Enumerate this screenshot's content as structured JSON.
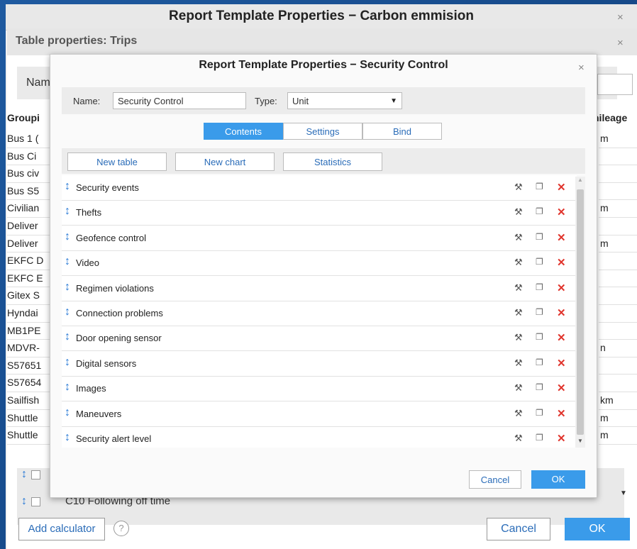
{
  "outer_dialog": {
    "title": "Report Template Properties − Carbon emmision",
    "close": "×"
  },
  "middle_dialog": {
    "title": "Table properties: Trips",
    "close": "×",
    "name_label": "Nam",
    "grouping_header": "Groupi",
    "mileage_header": "nileage",
    "left_rows": [
      "Bus 1 (",
      "Bus Ci",
      "Bus civ",
      "Bus S5",
      "Civilian",
      "Deliver",
      "Deliver",
      "EKFC D",
      "EKFC E",
      "Gitex S",
      "Hyndai",
      "MB1PE",
      "MDVR-",
      "S57651",
      "S57654",
      "Sailfish",
      "Shuttle",
      "Shuttle"
    ],
    "right_rows": [
      "m",
      "",
      "",
      "",
      "m",
      "",
      "m",
      "",
      "",
      "",
      "",
      "",
      "n",
      "",
      "",
      "km",
      "m",
      "m"
    ],
    "lower_text": "C10 Following off time",
    "add_calculator": "Add calculator",
    "help": "?",
    "cancel": "Cancel",
    "ok": "OK"
  },
  "inner_dialog": {
    "title": "Report Template Properties − Security Control",
    "close": "×",
    "name_label": "Name:",
    "name_value": "Security Control",
    "type_label": "Type:",
    "type_value": "Unit",
    "tabs": [
      "Contents",
      "Settings",
      "Bind"
    ],
    "active_tab": "Contents",
    "actions": [
      "New table",
      "New chart",
      "Statistics"
    ],
    "items": [
      "Security events",
      "Thefts",
      "Geofence control",
      "Video",
      "Regimen violations",
      "Connection problems",
      "Door opening sensor",
      "Digital sensors",
      "Images",
      "Maneuvers",
      "Security alert level"
    ],
    "cancel": "Cancel",
    "ok": "OK"
  },
  "icons": {
    "drag": "drag-handle-icon",
    "edit": "wrench-icon",
    "copy": "copy-icon",
    "delete": "delete-icon"
  },
  "colors": {
    "accent": "#3a9bea",
    "delete": "#e0342c",
    "link": "#2a6cb8"
  }
}
